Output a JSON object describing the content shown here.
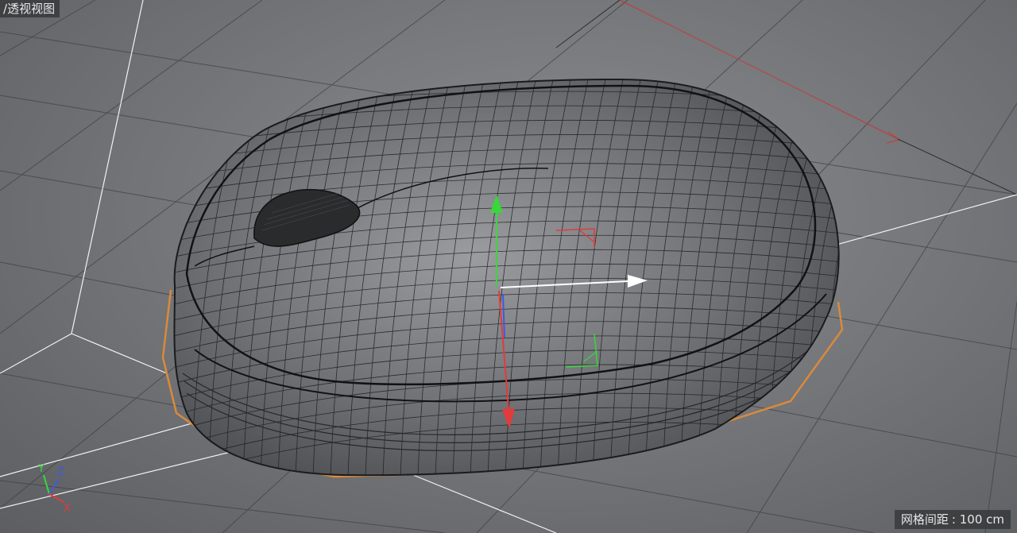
{
  "viewport": {
    "view_name": "透视视图",
    "view_name_prefix": "/",
    "grid_spacing_label": "网格间距",
    "grid_spacing_value": ": 100 cm"
  },
  "axis_indicator": {
    "x_label": "X",
    "y_label": "Y",
    "z_label": "Z"
  },
  "colors": {
    "x_axis": "#e23b3b",
    "y_axis": "#37d83a",
    "z_axis": "#3b5be2",
    "selection_outline": "#d98a3c",
    "mesh_fill": "#6c6e71",
    "wire": "#1d1e20"
  },
  "icons": {
    "move_gizmo": "move-gizmo-icon",
    "axis_orientation": "axis-orientation-icon"
  }
}
